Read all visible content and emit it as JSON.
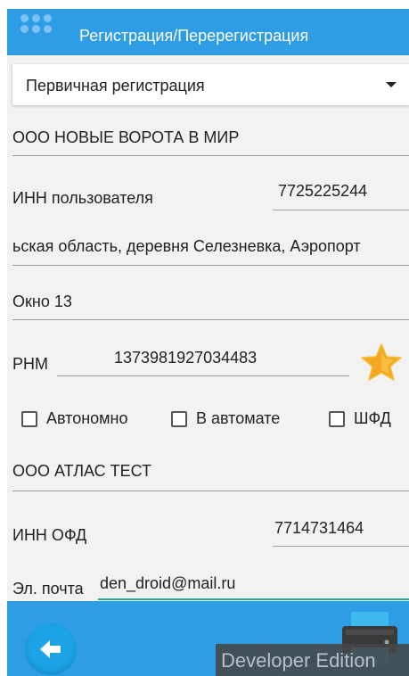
{
  "appbar": {
    "title": "Регистрация/Перерегистрация"
  },
  "registration_type": {
    "selected": "Первичная регистрация"
  },
  "form": {
    "org_name": "ООО НОВЫЕ ВОРОТА В МИР",
    "user_inn_label": "ИНН пользователя",
    "user_inn_value": "7725225244",
    "address": "ьская область, деревня Селезневка, Аэропорт",
    "window": "Окно 13",
    "rnm_label": "РНМ",
    "rnm_value": "1373981927034483",
    "checkboxes": [
      {
        "label": "Автономно",
        "checked": false
      },
      {
        "label": "В автомате",
        "checked": false
      },
      {
        "label": "ШФД",
        "checked": false
      }
    ],
    "ofd_name": "ООО АТЛАС ТЕСТ",
    "ofd_inn_label": "ИНН ОФД",
    "ofd_inn_value": "7714731464",
    "email_label": "Эл. почта",
    "email_value": "den_droid@mail.ru"
  },
  "icons": {
    "app_logo": "app-logo-icon",
    "dropdown": "chevron-down-icon",
    "favorite": "star-icon",
    "back": "arrow-left-icon",
    "print": "printer-icon"
  },
  "colors": {
    "primary": "#2f9ce6",
    "accent": "#26a69a",
    "star": "#f5a623"
  },
  "watermark": "Developer Edition"
}
